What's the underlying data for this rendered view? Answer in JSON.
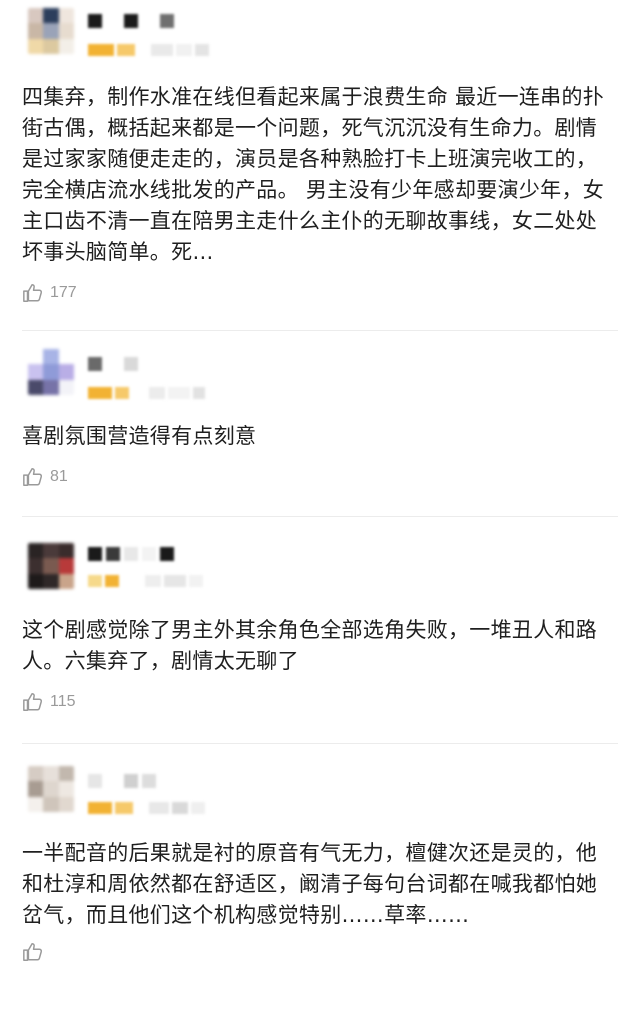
{
  "colors": {
    "text": "#1f1f1f",
    "muted": "#9a9a9a",
    "badge": "#f2b233",
    "divider": "#ececec"
  },
  "comments": [
    {
      "text": "四集弃，制作水准在线但看起来属于浪费生命 最近一连串的扑街古偶，概括起来都是一个问题，死气沉沉没有生命力。剧情是过家家随便走走的，演员是各种熟脸打卡上班演完收工的，完全横店流水线批发的产品。 男主没有少年感却要演少年，女主口齿不清一直在陪男主走什么主仆的无聊故事线，女二处处坏事头脑简单。死…",
      "likes": "177"
    },
    {
      "text": "喜剧氛围营造得有点刻意",
      "likes": "81"
    },
    {
      "text": "这个剧感觉除了男主外其余角色全部选角失败，一堆丑人和路人。六集弃了，剧情太无聊了",
      "likes": "115"
    },
    {
      "text": "一半配音的后果就是衬的原音有气无力，檀健次还是灵的，他和杜淳和周依然都在舒适区，阚清子每句台词都在喊我都怕她岔气，而且他们这个机构感觉特别……草率……",
      "likes": ""
    }
  ]
}
